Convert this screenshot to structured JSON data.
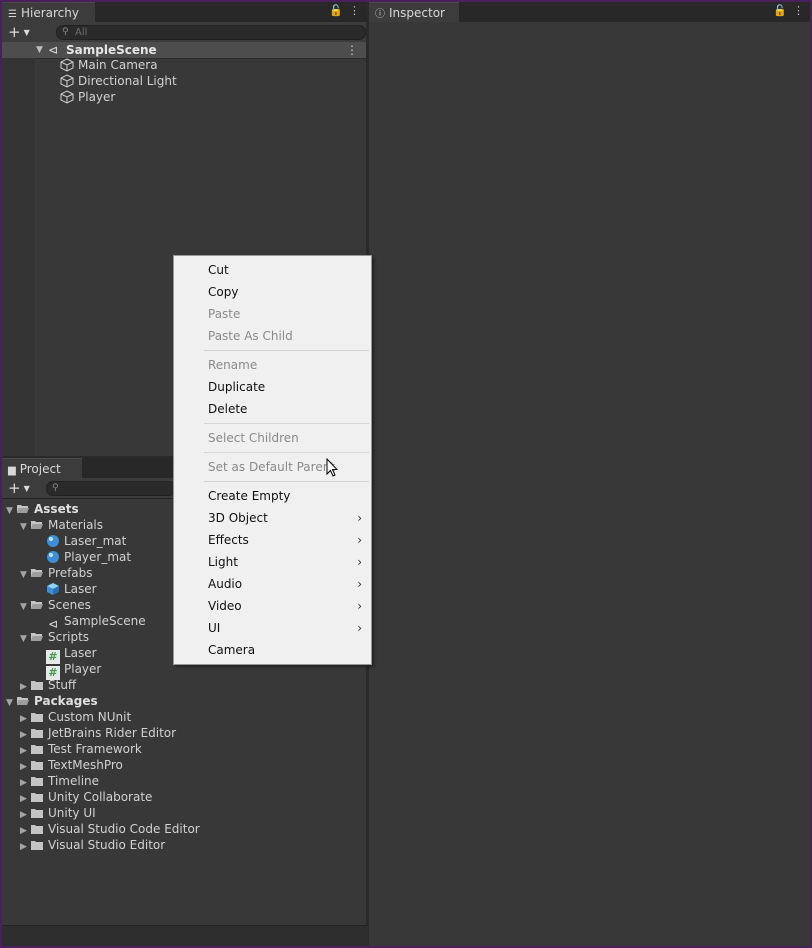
{
  "hierarchy": {
    "tab_label": "Hierarchy",
    "search_placeholder": "All",
    "scene_name": "SampleScene",
    "items": [
      "Main Camera",
      "Directional Light",
      "Player"
    ]
  },
  "inspector": {
    "tab_label": "Inspector"
  },
  "project": {
    "tab_label": "Project",
    "assets_label": "Assets",
    "materials_label": "Materials",
    "laser_mat": "Laser_mat",
    "player_mat": "Player_mat",
    "prefabs_label": "Prefabs",
    "laser_prefab": "Laser",
    "scenes_label": "Scenes",
    "scene_asset": "SampleScene",
    "scripts_label": "Scripts",
    "laser_script": "Laser",
    "player_script": "Player",
    "stuff_label": "Stuff",
    "packages_label": "Packages",
    "packages": [
      "Custom NUnit",
      "JetBrains Rider Editor",
      "Test Framework",
      "TextMeshPro",
      "Timeline",
      "Unity Collaborate",
      "Unity UI",
      "Visual Studio Code Editor",
      "Visual Studio Editor"
    ]
  },
  "context_menu": {
    "cut": "Cut",
    "copy": "Copy",
    "paste": "Paste",
    "paste_as_child": "Paste As Child",
    "rename": "Rename",
    "duplicate": "Duplicate",
    "delete": "Delete",
    "select_children": "Select Children",
    "set_default_parent": "Set as Default Parent",
    "create_empty": "Create Empty",
    "object_3d": "3D Object",
    "effects": "Effects",
    "light": "Light",
    "audio": "Audio",
    "video": "Video",
    "ui": "UI",
    "camera": "Camera"
  },
  "colors": {
    "accent_blue": "#3f8fd8",
    "script_green": "#3ea04a",
    "folder_gray": "#c4c4c4"
  }
}
